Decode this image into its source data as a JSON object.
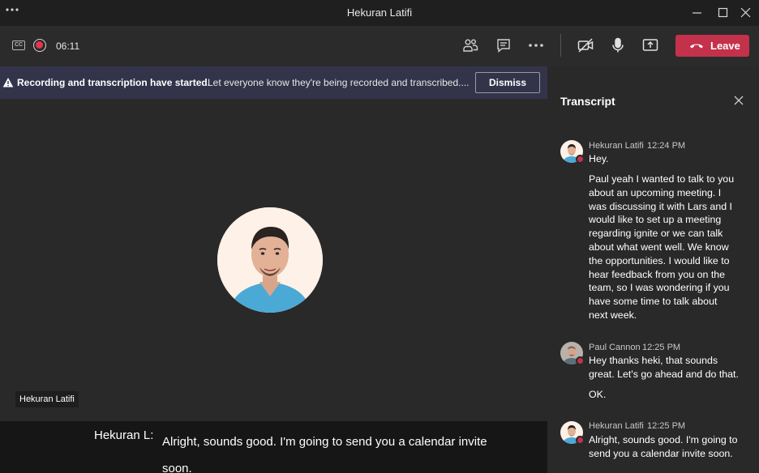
{
  "window": {
    "title": "Hekuran Latifi"
  },
  "toolbar": {
    "timer": "06:11",
    "leave_label": "Leave"
  },
  "banner": {
    "bold_text": "Recording and transcription have started.",
    "message": "Let everyone know they're being recorded and transcribed....",
    "dismiss_label": "Dismiss"
  },
  "stage": {
    "participant_name": "Hekuran Latifi"
  },
  "caption": {
    "speaker": "Hekuran L:",
    "text": "Alright, sounds good. I'm going to send you a calendar invite soon."
  },
  "transcript": {
    "title": "Transcript",
    "entries": [
      {
        "name": "Hekuran Latifi",
        "time": "12:24 PM",
        "messages": [
          "Hey.",
          "Paul yeah I wanted to talk to you about an upcoming meeting. I was discussing it with Lars and I would like to set up a meeting regarding ignite or we can talk about what went well. We know the opportunities. I would like to hear feedback from you on the team, so I was wondering if you have some time to talk about next week."
        ]
      },
      {
        "name": "Paul Cannon",
        "time": "12:25 PM",
        "messages": [
          "Hey thanks heki, that sounds great. Let's go ahead and do that.",
          "OK."
        ]
      },
      {
        "name": "Hekuran Latifi",
        "time": "12:25 PM",
        "messages": [
          "Alright, sounds good. I'm going to send you a calendar invite soon."
        ]
      }
    ]
  }
}
